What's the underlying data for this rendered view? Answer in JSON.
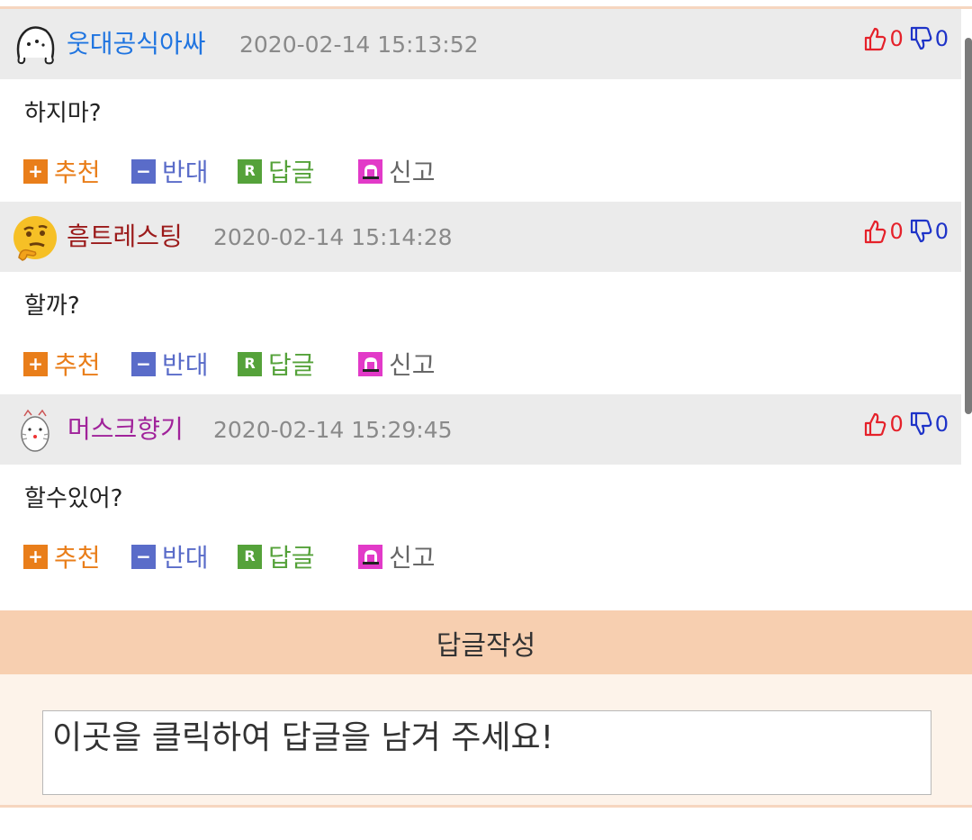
{
  "comments": [
    {
      "nickname": "웃대공식아싸",
      "nick_color": "#1f74e0",
      "date": "2020-02-14 15:13:52",
      "up": "0",
      "down": "0",
      "text": "하지마?"
    },
    {
      "nickname": "흠트레스팅",
      "nick_color": "#9b1a1a",
      "date": "2020-02-14 15:14:28",
      "up": "0",
      "down": "0",
      "text": "할까?"
    },
    {
      "nickname": "머스크향기",
      "nick_color": "#a0229a",
      "date": "2020-02-14 15:29:45",
      "up": "0",
      "down": "0",
      "text": "할수있어?"
    }
  ],
  "actions": {
    "recommend_label": "추천",
    "oppose_label": "반대",
    "reply_label": "답글",
    "report_label": "신고",
    "recommend_icon": "+",
    "oppose_icon": "−",
    "reply_icon": "R"
  },
  "reply_form": {
    "title": "답글작성",
    "placeholder": "이곳을 클릭하여 답글을 남겨 주세요!"
  },
  "colors": {
    "header_bg": "#ebebeb",
    "reply_header_bg": "#f7cfb0",
    "vote_up": "#e5212a",
    "vote_down": "#1e33c8"
  }
}
